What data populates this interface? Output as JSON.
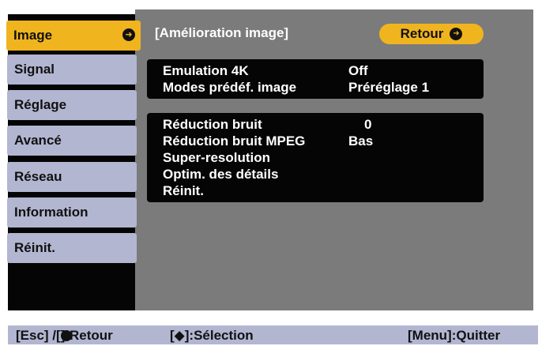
{
  "sidebar": {
    "items": [
      {
        "label": "Image",
        "active": true
      },
      {
        "label": "Signal",
        "active": false
      },
      {
        "label": "Réglage",
        "active": false
      },
      {
        "label": "Avancé",
        "active": false
      },
      {
        "label": "Réseau",
        "active": false
      },
      {
        "label": "Information",
        "active": false
      },
      {
        "label": "Réinit.",
        "active": false
      }
    ]
  },
  "main": {
    "title": "[Amélioration image]",
    "back_label": "Retour",
    "group1": [
      {
        "label": "Emulation 4K",
        "value": "Off"
      },
      {
        "label": "Modes prédéf. image",
        "value": "Préréglage 1"
      }
    ],
    "group2": [
      {
        "label": "Réduction bruit",
        "value": "0"
      },
      {
        "label": "Réduction bruit MPEG",
        "value": "Bas"
      },
      {
        "label": "Super-resolution",
        "value": ""
      },
      {
        "label": "Optim. des détails",
        "value": ""
      },
      {
        "label": "Réinit.",
        "value": ""
      }
    ]
  },
  "footer": {
    "esc_prefix": "[Esc] /[",
    "esc_suffix": "]:Retour",
    "select_prefix": "[",
    "select_suffix": "]:Sélection",
    "quit": "[Menu]:Quitter"
  },
  "colors": {
    "accent": "#f0b41f",
    "inactive_item": "#b2b6d1",
    "panel": "#7b7b7b",
    "row_bg": "#050505"
  },
  "icons": {
    "enter": "enter-circle-icon",
    "updown": "up-down-arrow-icon"
  }
}
